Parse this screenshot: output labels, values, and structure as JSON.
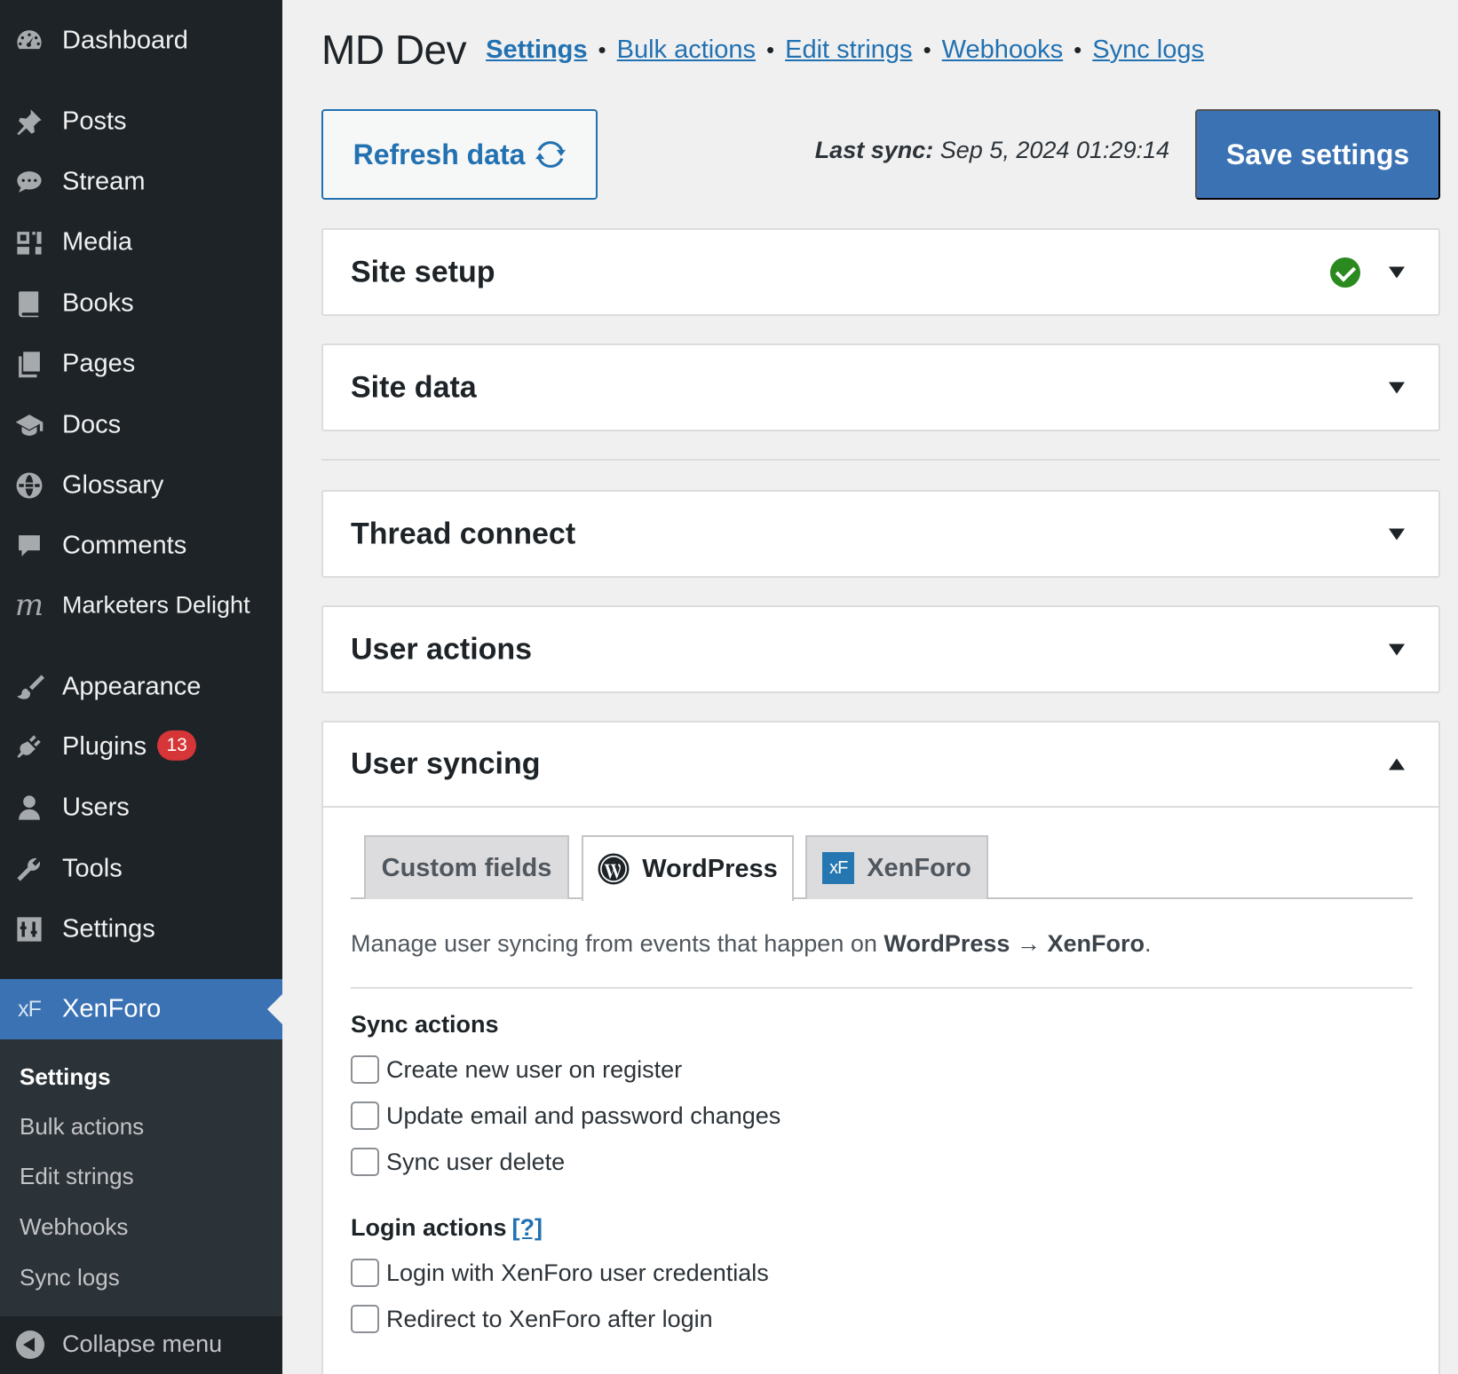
{
  "sidebar": {
    "items": [
      {
        "label": "Dashboard",
        "icon": "dashboard-icon"
      },
      {
        "label": "Posts",
        "icon": "pushpin-icon"
      },
      {
        "label": "Stream",
        "icon": "chat-bubble-icon"
      },
      {
        "label": "Media",
        "icon": "media-icon"
      },
      {
        "label": "Books",
        "icon": "book-icon"
      },
      {
        "label": "Pages",
        "icon": "pages-icon"
      },
      {
        "label": "Docs",
        "icon": "graduation-cap-icon"
      },
      {
        "label": "Glossary",
        "icon": "globe-icon"
      },
      {
        "label": "Comments",
        "icon": "comment-icon"
      },
      {
        "label": "Marketers Delight",
        "icon": "marketers-delight-logo-icon"
      },
      {
        "label": "Appearance",
        "icon": "paintbrush-icon"
      },
      {
        "label": "Plugins",
        "icon": "plug-icon",
        "badge": "13"
      },
      {
        "label": "Users",
        "icon": "user-icon"
      },
      {
        "label": "Tools",
        "icon": "wrench-icon"
      },
      {
        "label": "Settings",
        "icon": "sliders-icon"
      },
      {
        "label": "XenForo",
        "icon": "xenforo-logo-icon"
      }
    ],
    "submenu": [
      "Settings",
      "Bulk actions",
      "Edit strings",
      "Webhooks",
      "Sync logs"
    ],
    "collapse_label": "Collapse menu",
    "colors": {
      "background": "#1d2327",
      "active": "#3a72b4",
      "badge": "#d63638"
    }
  },
  "header": {
    "title": "MD Dev",
    "links": [
      "Settings",
      "Bulk actions",
      "Edit strings",
      "Webhooks",
      "Sync logs"
    ],
    "separator": "•"
  },
  "toolbar": {
    "refresh_label": "Refresh data",
    "refresh_icon": "refresh-icon",
    "last_sync_label": "Last sync:",
    "last_sync_value": "Sep 5, 2024 01:29:14",
    "save_label": "Save settings"
  },
  "panels": [
    {
      "title": "Site setup",
      "expanded": false,
      "status": "complete"
    },
    {
      "title": "Site data",
      "expanded": false
    },
    {
      "title": "Thread connect",
      "expanded": false
    },
    {
      "title": "User actions",
      "expanded": false
    },
    {
      "title": "User syncing",
      "expanded": true
    }
  ],
  "user_syncing": {
    "tabs": [
      {
        "label": "Custom fields",
        "active": false
      },
      {
        "label": "WordPress",
        "active": true,
        "icon": "wordpress-logo-icon"
      },
      {
        "label": "XenForo",
        "active": false,
        "icon": "xenforo-logo-icon",
        "logo_text": "xF"
      }
    ],
    "intro_prefix": "Manage user syncing from events that happen on",
    "intro_source": "WordPress",
    "intro_arrow": "→",
    "intro_target": "XenForo",
    "intro_suffix": ".",
    "sync_actions_label": "Sync actions",
    "sync_actions": [
      {
        "label": "Create new user on register",
        "checked": false
      },
      {
        "label": "Update email and password changes",
        "checked": false
      },
      {
        "label": "Sync user delete",
        "checked": false
      }
    ],
    "login_actions_label": "Login actions",
    "login_help": "[?]",
    "login_actions": [
      {
        "label": "Login with XenForo user credentials",
        "checked": false
      },
      {
        "label": "Redirect to XenForo after login",
        "checked": false
      }
    ]
  },
  "colors": {
    "accent": "#2271b1",
    "primary_button": "#3a72b4",
    "success": "#2b8a1f",
    "background": "#f0f0f1"
  }
}
